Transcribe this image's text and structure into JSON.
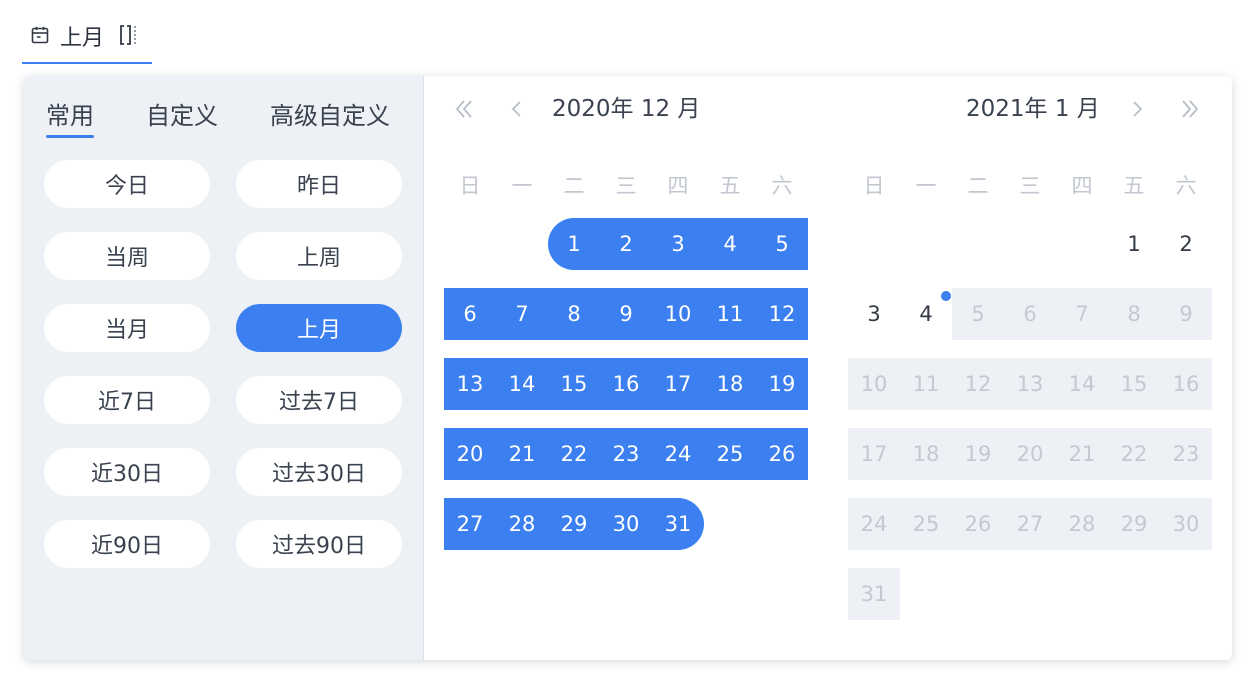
{
  "trigger": {
    "icon": "calendar-icon",
    "label": "上月",
    "dropdown_icon": "range-bracket-icon"
  },
  "sidebar": {
    "tabs": [
      {
        "label": "常用",
        "active": true
      },
      {
        "label": "自定义",
        "active": false
      },
      {
        "label": "高级自定义",
        "active": false
      }
    ],
    "quick_options": [
      {
        "label": "今日",
        "active": false
      },
      {
        "label": "昨日",
        "active": false
      },
      {
        "label": "当周",
        "active": false
      },
      {
        "label": "上周",
        "active": false
      },
      {
        "label": "当月",
        "active": false
      },
      {
        "label": "上月",
        "active": true
      },
      {
        "label": "近7日",
        "active": false
      },
      {
        "label": "过去7日",
        "active": false
      },
      {
        "label": "近30日",
        "active": false
      },
      {
        "label": "过去30日",
        "active": false
      },
      {
        "label": "近90日",
        "active": false
      },
      {
        "label": "过去90日",
        "active": false
      }
    ]
  },
  "weekdays": [
    "日",
    "一",
    "二",
    "三",
    "四",
    "五",
    "六"
  ],
  "calendars": [
    {
      "title": "2020年 12 月",
      "first_weekday": 2,
      "days": 31,
      "range": [
        1,
        31
      ],
      "today": null,
      "disabled_from": null
    },
    {
      "title": "2021年 1 月",
      "first_weekday": 5,
      "days": 31,
      "range": null,
      "today": 4,
      "disabled_from": 5
    }
  ],
  "nav": {
    "prev_year_icon": "double-chevron-left-icon",
    "prev_month_icon": "chevron-left-icon",
    "next_month_icon": "chevron-right-icon",
    "next_year_icon": "double-chevron-right-icon"
  },
  "colors": {
    "accent": "#3b7ff0",
    "sidebar_bg": "#edf1f6",
    "disabled_bg": "#edf1f6",
    "disabled_text": "#c4c9d1"
  }
}
